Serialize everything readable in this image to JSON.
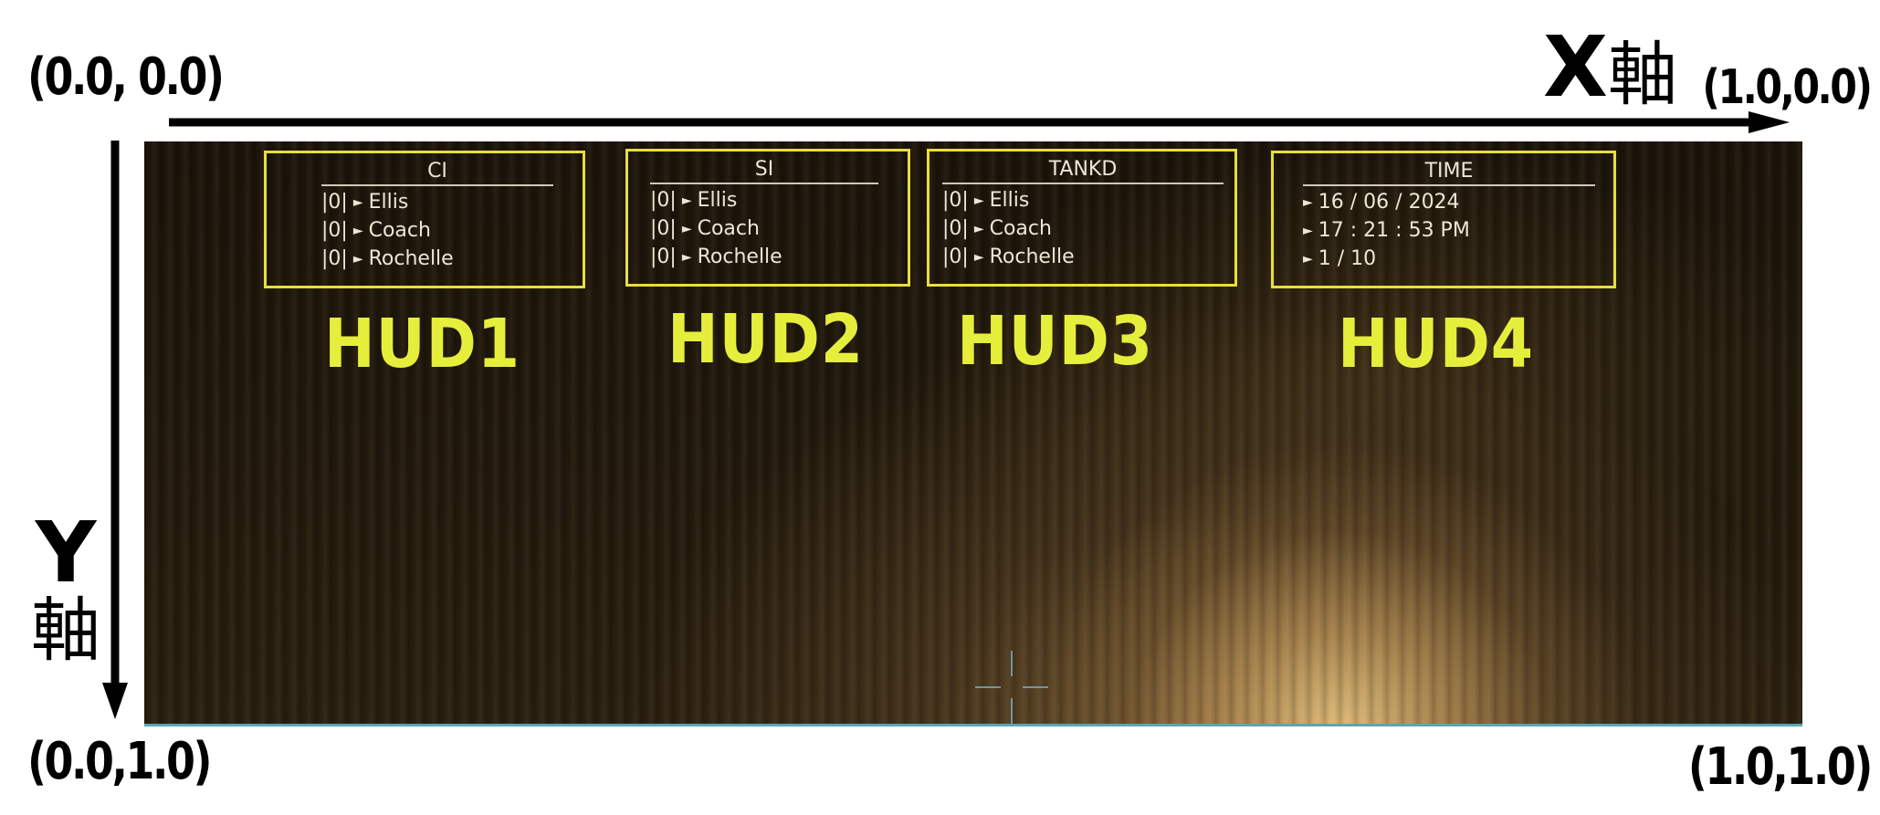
{
  "corners": {
    "top_left": "(0.0, 0.0)",
    "top_right": "(1.0,0.0)",
    "bottom_left": "(0.0,1.0)",
    "bottom_right": "(1.0,1.0)"
  },
  "axes": {
    "x": {
      "letter": "X",
      "kanji": "軸"
    },
    "y": {
      "letter": "Y",
      "kanji": "軸"
    }
  },
  "hud": [
    {
      "title": "CI",
      "caption": "HUD1",
      "rows": [
        {
          "count": "|0|",
          "glyph": "►",
          "name": "Ellis"
        },
        {
          "count": "|0|",
          "glyph": "►",
          "name": "Coach"
        },
        {
          "count": "|0|",
          "glyph": "►",
          "name": "Rochelle"
        }
      ]
    },
    {
      "title": "SI",
      "caption": "HUD2",
      "rows": [
        {
          "count": "|0|",
          "glyph": "►",
          "name": "Ellis"
        },
        {
          "count": "|0|",
          "glyph": "►",
          "name": "Coach"
        },
        {
          "count": "|0|",
          "glyph": "►",
          "name": "Rochelle"
        }
      ]
    },
    {
      "title": "TANKD",
      "caption": "HUD3",
      "rows": [
        {
          "count": "|0|",
          "glyph": "►",
          "name": "Ellis"
        },
        {
          "count": "|0|",
          "glyph": "►",
          "name": "Coach"
        },
        {
          "count": "|0|",
          "glyph": "►",
          "name": "Rochelle"
        }
      ]
    },
    {
      "title": "TIME",
      "caption": "HUD4",
      "rows": [
        {
          "count": "",
          "glyph": "►",
          "name": "16 / 06 / 2024"
        },
        {
          "count": "",
          "glyph": "►",
          "name": "17 : 21 : 53 PM"
        },
        {
          "count": "",
          "glyph": "►",
          "name": "1 / 10"
        }
      ]
    }
  ],
  "colors": {
    "hud_border": "#e8de3c",
    "hud_caption": "#e6ee3c",
    "hud_text": "#ece6d6",
    "view_bottom_line": "#5aa6b4",
    "crosshair": "#7fb4c8"
  },
  "icons": {
    "row_marker": "play-triangle-icon",
    "aim": "crosshair-icon"
  }
}
